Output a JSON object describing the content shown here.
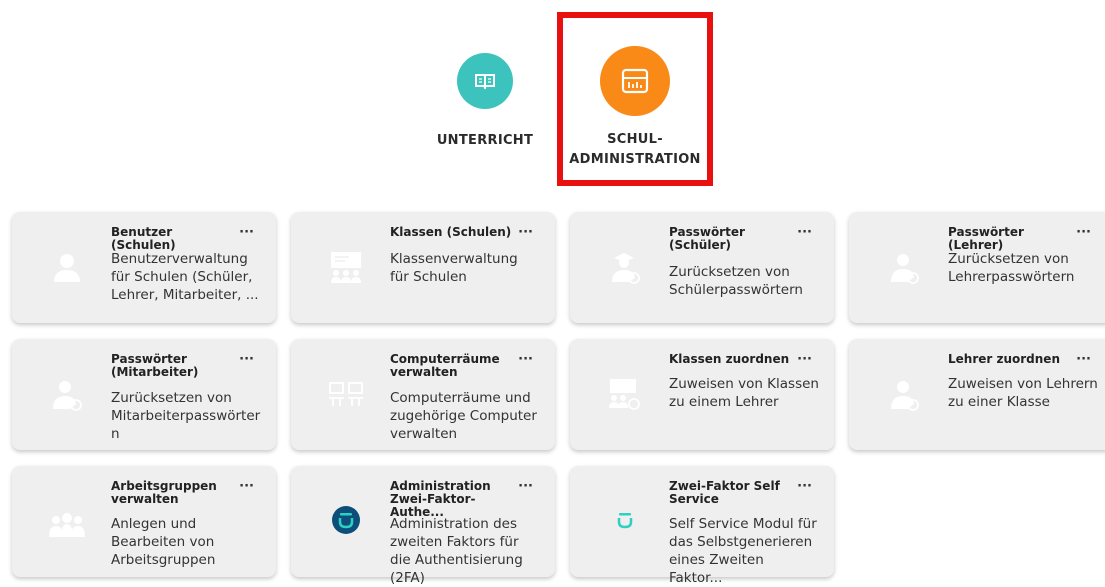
{
  "categories": [
    {
      "label": "UNTERRICHT",
      "color": "#3cc3bd",
      "icon": "book-icon"
    },
    {
      "label_line1": "SCHUL-",
      "label_line2": "ADMINISTRATION",
      "color": "#f98a17",
      "icon": "administration-icon"
    }
  ],
  "tiles": [
    {
      "title": "Benutzer (Schulen)",
      "desc": "Benutzerverwaltung für Schulen (Schüler, Lehrer, Mitarbeiter, ...",
      "icon": "user-icon",
      "more": "···"
    },
    {
      "title": "Klassen (Schulen)",
      "desc": "Klassenverwaltung für Schulen",
      "icon": "class-icon",
      "more": "···"
    },
    {
      "title": "Passwörter (Schüler)",
      "desc": "Zurücksetzen von Schülerpasswörtern",
      "icon": "student-password-icon",
      "more": "···"
    },
    {
      "title": "Passwörter (Lehrer)",
      "desc": "Zurücksetzen von Lehrerpasswörtern",
      "icon": "teacher-password-icon",
      "more": "···"
    },
    {
      "title": "Passwörter (Mitarbeiter)",
      "desc": "Zurücksetzen von Mitarbeiterpasswörter n",
      "icon": "staff-password-icon",
      "more": "···"
    },
    {
      "title": "Computerräume verwalten",
      "desc": "Computerräume und zugehörige Computer verwalten",
      "icon": "computer-room-icon",
      "more": "···"
    },
    {
      "title": "Klassen zuordnen",
      "desc": "Zuweisen von Klassen zu einem Lehrer",
      "icon": "assign-class-icon",
      "more": "···"
    },
    {
      "title": "Lehrer zuordnen",
      "desc": "Zuweisen von Lehrern zu einer Klasse",
      "icon": "assign-teacher-icon",
      "more": "···"
    },
    {
      "title": "Arbeitsgruppen verwalten",
      "desc": "Anlegen und Bearbeiten von Arbeitsgruppen",
      "icon": "workgroup-icon",
      "more": "···"
    },
    {
      "title": "Administration Zwei-Faktor-Authe...",
      "desc": "Administration des zweiten Faktors für die Authentisierung (2FA)",
      "icon": "two-factor-admin-icon",
      "more": "···"
    },
    {
      "title": "Zwei-Faktor Self Service",
      "desc": "Self Service Modul für das Selbstgenerieren eines Zweiten Faktor...",
      "icon": "two-factor-self-service-icon",
      "more": "···"
    }
  ]
}
